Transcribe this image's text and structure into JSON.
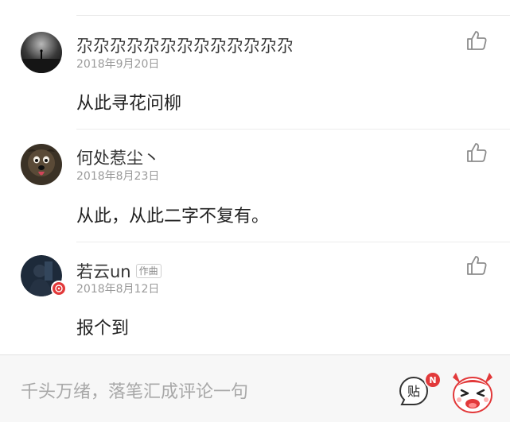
{
  "comments": [
    {
      "author": "尕尕尕尕尕尕尕尕尕尕尕尕尕",
      "tag": "",
      "date": "2018年9月20日",
      "text": "从此寻花问柳"
    },
    {
      "author": "何处惹尘丶",
      "tag": "",
      "date": "2018年8月23日",
      "text": "从此，从此二字不复有。"
    },
    {
      "author": "若云un",
      "tag": "作曲",
      "date": "2018年8月12日",
      "text": "报个到"
    }
  ],
  "input": {
    "placeholder": "千头万绪，落笔汇成评论一句"
  },
  "post_button": {
    "label": "贴",
    "badge": "N"
  },
  "icons": {
    "like": "thumbs-up-icon",
    "post": "post-sticker-icon",
    "emoji": "emoji-face-icon"
  },
  "colors": {
    "badge": "#e2393a",
    "date": "#9a9a9a",
    "placeholder": "#a8a8a8"
  }
}
